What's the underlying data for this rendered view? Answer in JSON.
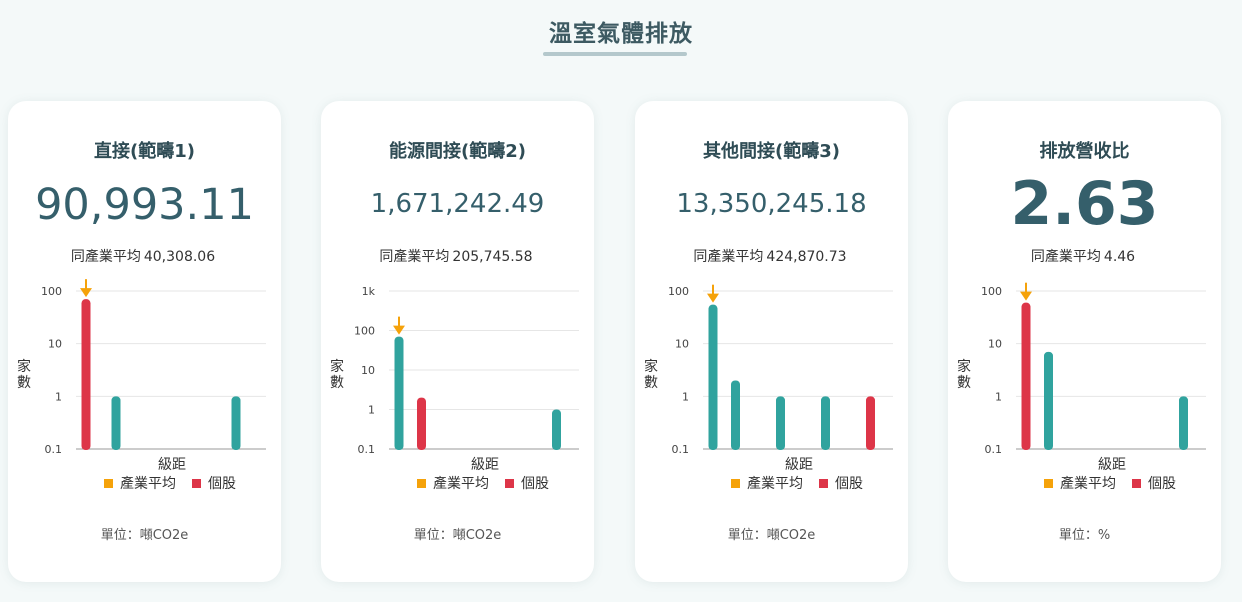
{
  "page": {
    "title": "溫室氣體排放"
  },
  "legend": {
    "average": "產業平均",
    "company": "個股"
  },
  "axis": {
    "ylabel": "家數",
    "xlabel": "級距"
  },
  "colors": {
    "teal": "#30a39e",
    "red": "#dd3548",
    "orange": "#f5a20a",
    "grid": "#e6e6e6"
  },
  "cards": [
    {
      "title": "直接(範疇1)",
      "value": "90,993.11",
      "avg_label": "同產業平均",
      "avg_value": "40,308.06",
      "unit": "單位：噸CO2e"
    },
    {
      "title": "能源間接(範疇2)",
      "value": "1,671,242.49",
      "avg_label": "同產業平均",
      "avg_value": "205,745.58",
      "unit": "單位：噸CO2e"
    },
    {
      "title": "其他間接(範疇3)",
      "value": "13,350,245.18",
      "avg_label": "同產業平均",
      "avg_value": "424,870.73",
      "unit": "單位：噸CO2e"
    },
    {
      "title": "排放營收比",
      "value": "2.63",
      "avg_label": "同產業平均",
      "avg_value": "4.46",
      "unit": "單位：%"
    }
  ],
  "chart_data": [
    {
      "type": "bar",
      "yscale": "log",
      "ylim": [
        0.1,
        100
      ],
      "yticks": [
        "100",
        "10",
        "1",
        "0.1"
      ],
      "ylabel": "家數",
      "xlabel": "級距",
      "bins": 6,
      "values": [
        70,
        1,
        0,
        0,
        0,
        1
      ],
      "highlight_bin": 0,
      "average_bin": 0
    },
    {
      "type": "bar",
      "yscale": "log",
      "ylim": [
        0.1,
        1000
      ],
      "yticks": [
        "1k",
        "100",
        "10",
        "1",
        "0.1"
      ],
      "ylabel": "家數",
      "xlabel": "級距",
      "bins": 8,
      "values": [
        70,
        2,
        0,
        0,
        0,
        0,
        0,
        1
      ],
      "highlight_bin": 1,
      "average_bin": 0
    },
    {
      "type": "bar",
      "yscale": "log",
      "ylim": [
        0.1,
        100
      ],
      "yticks": [
        "100",
        "10",
        "1",
        "0.1"
      ],
      "ylabel": "家數",
      "xlabel": "級距",
      "bins": 8,
      "values": [
        55,
        2,
        0,
        1,
        0,
        1,
        0,
        1
      ],
      "highlight_bin": 7,
      "average_bin": 0
    },
    {
      "type": "bar",
      "yscale": "log",
      "ylim": [
        0.1,
        100
      ],
      "yticks": [
        "100",
        "10",
        "1",
        "0.1"
      ],
      "ylabel": "家數",
      "xlabel": "級距",
      "bins": 8,
      "values": [
        60,
        7,
        0,
        0,
        0,
        0,
        0,
        1
      ],
      "highlight_bin": 0,
      "average_bin": 0
    }
  ]
}
